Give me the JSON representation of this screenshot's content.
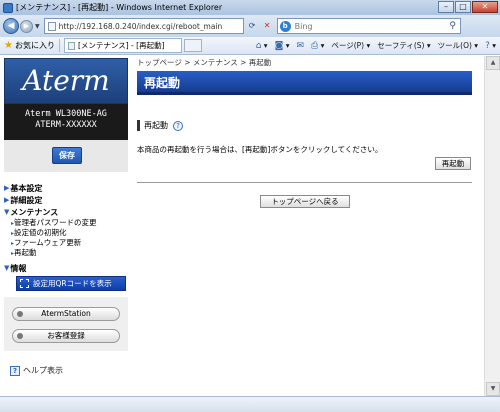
{
  "window": {
    "title": "[メンテナンス] - [再起動] - Windows Internet Explorer"
  },
  "browser": {
    "url": "http://192.168.0.240/index.cgi/reboot_main",
    "search_placeholder": "Bing",
    "favorites_label": "お気に入り",
    "tab_title": "[メンテナンス] - [再起動]",
    "tools": {
      "page": "ページ(P)",
      "safety": "セーフティ(S)",
      "tools": "ツール(O)"
    }
  },
  "sidebar": {
    "logo_text": "Aterm",
    "model_line1": "Aterm WL300NE-AG",
    "model_line2": "ATERM-XXXXXX",
    "save_label": "保存",
    "nav": {
      "basic": "基本設定",
      "detail": "詳細設定",
      "maintenance": "メンテナンス",
      "maintenance_items": [
        "管理者パスワードの変更",
        "設定値の初期化",
        "ファームウェア更新",
        "再起動"
      ],
      "info": "情報"
    },
    "qr_label": "設定用QRコードを表示",
    "aterm_station_label": "AtermStation",
    "customer_register_label": "お客様登録",
    "help_label": "ヘルプ表示"
  },
  "main": {
    "breadcrumb": "トップページ > メンテナンス > 再起動",
    "page_title": "再起動",
    "section_title": "再起動",
    "description": "本商品の再起動を行う場合は、[再起動]ボタンをクリックしてください。",
    "reboot_button": "再起動",
    "back_button": "トップページへ戻る"
  }
}
